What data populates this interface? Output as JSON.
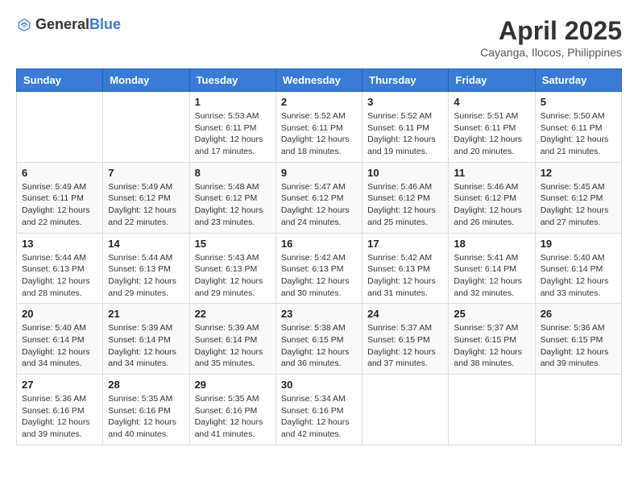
{
  "header": {
    "logo_general": "General",
    "logo_blue": "Blue",
    "month_title": "April 2025",
    "location": "Cayanga, Ilocos, Philippines"
  },
  "days_of_week": [
    "Sunday",
    "Monday",
    "Tuesday",
    "Wednesday",
    "Thursday",
    "Friday",
    "Saturday"
  ],
  "weeks": [
    [
      {
        "day": "",
        "info": ""
      },
      {
        "day": "",
        "info": ""
      },
      {
        "day": "1",
        "info": "Sunrise: 5:53 AM\nSunset: 6:11 PM\nDaylight: 12 hours and 17 minutes."
      },
      {
        "day": "2",
        "info": "Sunrise: 5:52 AM\nSunset: 6:11 PM\nDaylight: 12 hours and 18 minutes."
      },
      {
        "day": "3",
        "info": "Sunrise: 5:52 AM\nSunset: 6:11 PM\nDaylight: 12 hours and 19 minutes."
      },
      {
        "day": "4",
        "info": "Sunrise: 5:51 AM\nSunset: 6:11 PM\nDaylight: 12 hours and 20 minutes."
      },
      {
        "day": "5",
        "info": "Sunrise: 5:50 AM\nSunset: 6:11 PM\nDaylight: 12 hours and 21 minutes."
      }
    ],
    [
      {
        "day": "6",
        "info": "Sunrise: 5:49 AM\nSunset: 6:11 PM\nDaylight: 12 hours and 22 minutes."
      },
      {
        "day": "7",
        "info": "Sunrise: 5:49 AM\nSunset: 6:12 PM\nDaylight: 12 hours and 22 minutes."
      },
      {
        "day": "8",
        "info": "Sunrise: 5:48 AM\nSunset: 6:12 PM\nDaylight: 12 hours and 23 minutes."
      },
      {
        "day": "9",
        "info": "Sunrise: 5:47 AM\nSunset: 6:12 PM\nDaylight: 12 hours and 24 minutes."
      },
      {
        "day": "10",
        "info": "Sunrise: 5:46 AM\nSunset: 6:12 PM\nDaylight: 12 hours and 25 minutes."
      },
      {
        "day": "11",
        "info": "Sunrise: 5:46 AM\nSunset: 6:12 PM\nDaylight: 12 hours and 26 minutes."
      },
      {
        "day": "12",
        "info": "Sunrise: 5:45 AM\nSunset: 6:12 PM\nDaylight: 12 hours and 27 minutes."
      }
    ],
    [
      {
        "day": "13",
        "info": "Sunrise: 5:44 AM\nSunset: 6:13 PM\nDaylight: 12 hours and 28 minutes."
      },
      {
        "day": "14",
        "info": "Sunrise: 5:44 AM\nSunset: 6:13 PM\nDaylight: 12 hours and 29 minutes."
      },
      {
        "day": "15",
        "info": "Sunrise: 5:43 AM\nSunset: 6:13 PM\nDaylight: 12 hours and 29 minutes."
      },
      {
        "day": "16",
        "info": "Sunrise: 5:42 AM\nSunset: 6:13 PM\nDaylight: 12 hours and 30 minutes."
      },
      {
        "day": "17",
        "info": "Sunrise: 5:42 AM\nSunset: 6:13 PM\nDaylight: 12 hours and 31 minutes."
      },
      {
        "day": "18",
        "info": "Sunrise: 5:41 AM\nSunset: 6:14 PM\nDaylight: 12 hours and 32 minutes."
      },
      {
        "day": "19",
        "info": "Sunrise: 5:40 AM\nSunset: 6:14 PM\nDaylight: 12 hours and 33 minutes."
      }
    ],
    [
      {
        "day": "20",
        "info": "Sunrise: 5:40 AM\nSunset: 6:14 PM\nDaylight: 12 hours and 34 minutes."
      },
      {
        "day": "21",
        "info": "Sunrise: 5:39 AM\nSunset: 6:14 PM\nDaylight: 12 hours and 34 minutes."
      },
      {
        "day": "22",
        "info": "Sunrise: 5:39 AM\nSunset: 6:14 PM\nDaylight: 12 hours and 35 minutes."
      },
      {
        "day": "23",
        "info": "Sunrise: 5:38 AM\nSunset: 6:15 PM\nDaylight: 12 hours and 36 minutes."
      },
      {
        "day": "24",
        "info": "Sunrise: 5:37 AM\nSunset: 6:15 PM\nDaylight: 12 hours and 37 minutes."
      },
      {
        "day": "25",
        "info": "Sunrise: 5:37 AM\nSunset: 6:15 PM\nDaylight: 12 hours and 38 minutes."
      },
      {
        "day": "26",
        "info": "Sunrise: 5:36 AM\nSunset: 6:15 PM\nDaylight: 12 hours and 39 minutes."
      }
    ],
    [
      {
        "day": "27",
        "info": "Sunrise: 5:36 AM\nSunset: 6:16 PM\nDaylight: 12 hours and 39 minutes."
      },
      {
        "day": "28",
        "info": "Sunrise: 5:35 AM\nSunset: 6:16 PM\nDaylight: 12 hours and 40 minutes."
      },
      {
        "day": "29",
        "info": "Sunrise: 5:35 AM\nSunset: 6:16 PM\nDaylight: 12 hours and 41 minutes."
      },
      {
        "day": "30",
        "info": "Sunrise: 5:34 AM\nSunset: 6:16 PM\nDaylight: 12 hours and 42 minutes."
      },
      {
        "day": "",
        "info": ""
      },
      {
        "day": "",
        "info": ""
      },
      {
        "day": "",
        "info": ""
      }
    ]
  ]
}
